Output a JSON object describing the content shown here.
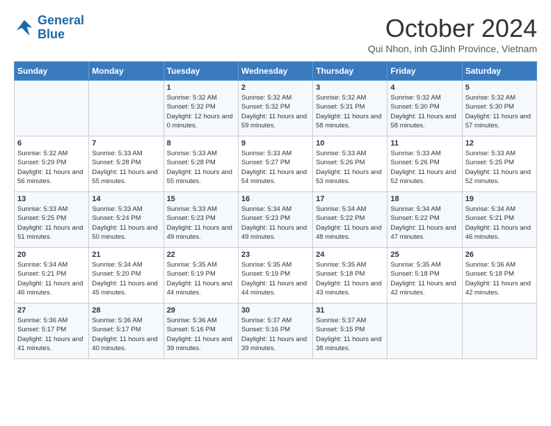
{
  "header": {
    "logo_line1": "General",
    "logo_line2": "Blue",
    "month": "October 2024",
    "location": "Qui Nhon, inh GJinh Province, Vietnam"
  },
  "days_of_week": [
    "Sunday",
    "Monday",
    "Tuesday",
    "Wednesday",
    "Thursday",
    "Friday",
    "Saturday"
  ],
  "weeks": [
    [
      {
        "day": "",
        "info": ""
      },
      {
        "day": "",
        "info": ""
      },
      {
        "day": "1",
        "info": "Sunrise: 5:32 AM\nSunset: 5:32 PM\nDaylight: 12 hours\nand 0 minutes."
      },
      {
        "day": "2",
        "info": "Sunrise: 5:32 AM\nSunset: 5:32 PM\nDaylight: 11 hours\nand 59 minutes."
      },
      {
        "day": "3",
        "info": "Sunrise: 5:32 AM\nSunset: 5:31 PM\nDaylight: 11 hours\nand 58 minutes."
      },
      {
        "day": "4",
        "info": "Sunrise: 5:32 AM\nSunset: 5:30 PM\nDaylight: 11 hours\nand 58 minutes."
      },
      {
        "day": "5",
        "info": "Sunrise: 5:32 AM\nSunset: 5:30 PM\nDaylight: 11 hours\nand 57 minutes."
      }
    ],
    [
      {
        "day": "6",
        "info": "Sunrise: 5:32 AM\nSunset: 5:29 PM\nDaylight: 11 hours\nand 56 minutes."
      },
      {
        "day": "7",
        "info": "Sunrise: 5:33 AM\nSunset: 5:28 PM\nDaylight: 11 hours\nand 55 minutes."
      },
      {
        "day": "8",
        "info": "Sunrise: 5:33 AM\nSunset: 5:28 PM\nDaylight: 11 hours\nand 55 minutes."
      },
      {
        "day": "9",
        "info": "Sunrise: 5:33 AM\nSunset: 5:27 PM\nDaylight: 11 hours\nand 54 minutes."
      },
      {
        "day": "10",
        "info": "Sunrise: 5:33 AM\nSunset: 5:26 PM\nDaylight: 11 hours\nand 53 minutes."
      },
      {
        "day": "11",
        "info": "Sunrise: 5:33 AM\nSunset: 5:26 PM\nDaylight: 11 hours\nand 52 minutes."
      },
      {
        "day": "12",
        "info": "Sunrise: 5:33 AM\nSunset: 5:25 PM\nDaylight: 11 hours\nand 52 minutes."
      }
    ],
    [
      {
        "day": "13",
        "info": "Sunrise: 5:33 AM\nSunset: 5:25 PM\nDaylight: 11 hours\nand 51 minutes."
      },
      {
        "day": "14",
        "info": "Sunrise: 5:33 AM\nSunset: 5:24 PM\nDaylight: 11 hours\nand 50 minutes."
      },
      {
        "day": "15",
        "info": "Sunrise: 5:33 AM\nSunset: 5:23 PM\nDaylight: 11 hours\nand 49 minutes."
      },
      {
        "day": "16",
        "info": "Sunrise: 5:34 AM\nSunset: 5:23 PM\nDaylight: 11 hours\nand 49 minutes."
      },
      {
        "day": "17",
        "info": "Sunrise: 5:34 AM\nSunset: 5:22 PM\nDaylight: 11 hours\nand 48 minutes."
      },
      {
        "day": "18",
        "info": "Sunrise: 5:34 AM\nSunset: 5:22 PM\nDaylight: 11 hours\nand 47 minutes."
      },
      {
        "day": "19",
        "info": "Sunrise: 5:34 AM\nSunset: 5:21 PM\nDaylight: 11 hours\nand 46 minutes."
      }
    ],
    [
      {
        "day": "20",
        "info": "Sunrise: 5:34 AM\nSunset: 5:21 PM\nDaylight: 11 hours\nand 46 minutes."
      },
      {
        "day": "21",
        "info": "Sunrise: 5:34 AM\nSunset: 5:20 PM\nDaylight: 11 hours\nand 45 minutes."
      },
      {
        "day": "22",
        "info": "Sunrise: 5:35 AM\nSunset: 5:19 PM\nDaylight: 11 hours\nand 44 minutes."
      },
      {
        "day": "23",
        "info": "Sunrise: 5:35 AM\nSunset: 5:19 PM\nDaylight: 11 hours\nand 44 minutes."
      },
      {
        "day": "24",
        "info": "Sunrise: 5:35 AM\nSunset: 5:18 PM\nDaylight: 11 hours\nand 43 minutes."
      },
      {
        "day": "25",
        "info": "Sunrise: 5:35 AM\nSunset: 5:18 PM\nDaylight: 11 hours\nand 42 minutes."
      },
      {
        "day": "26",
        "info": "Sunrise: 5:36 AM\nSunset: 5:18 PM\nDaylight: 11 hours\nand 42 minutes."
      }
    ],
    [
      {
        "day": "27",
        "info": "Sunrise: 5:36 AM\nSunset: 5:17 PM\nDaylight: 11 hours\nand 41 minutes."
      },
      {
        "day": "28",
        "info": "Sunrise: 5:36 AM\nSunset: 5:17 PM\nDaylight: 11 hours\nand 40 minutes."
      },
      {
        "day": "29",
        "info": "Sunrise: 5:36 AM\nSunset: 5:16 PM\nDaylight: 11 hours\nand 39 minutes."
      },
      {
        "day": "30",
        "info": "Sunrise: 5:37 AM\nSunset: 5:16 PM\nDaylight: 11 hours\nand 39 minutes."
      },
      {
        "day": "31",
        "info": "Sunrise: 5:37 AM\nSunset: 5:15 PM\nDaylight: 11 hours\nand 38 minutes."
      },
      {
        "day": "",
        "info": ""
      },
      {
        "day": "",
        "info": ""
      }
    ]
  ]
}
